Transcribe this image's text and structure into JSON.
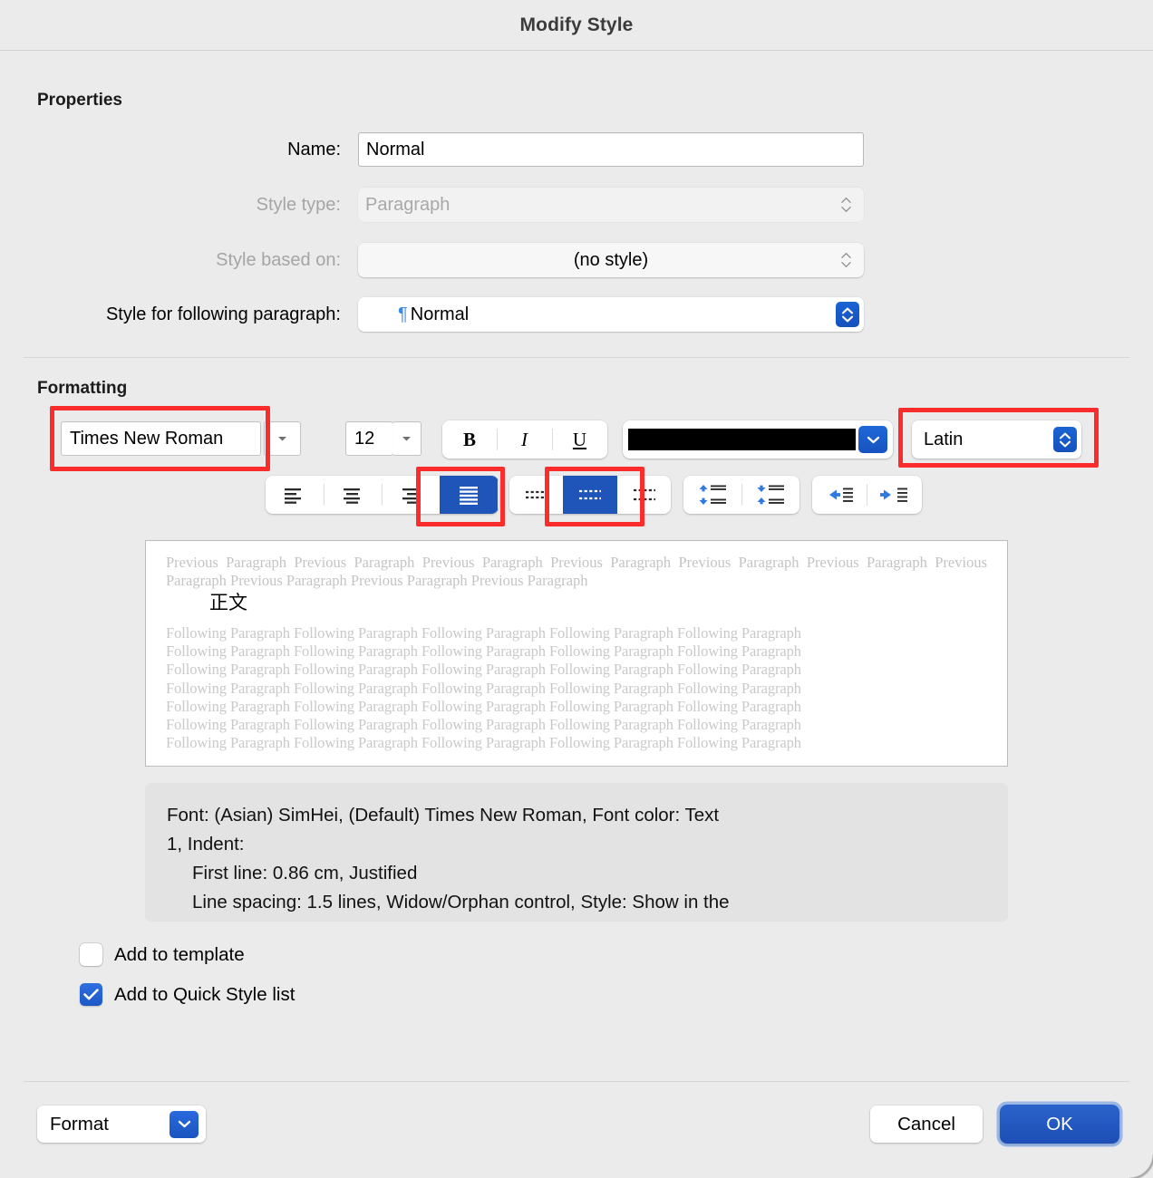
{
  "window": {
    "title": "Modify Style"
  },
  "properties": {
    "heading": "Properties",
    "name": {
      "label": "Name:",
      "value": "Normal"
    },
    "style_type": {
      "label": "Style type:",
      "value": "Paragraph"
    },
    "style_based_on": {
      "label": "Style based on:",
      "value": "(no style)"
    },
    "style_following": {
      "label": "Style for following paragraph:",
      "value": "Normal",
      "icon": "pilcrow-icon"
    }
  },
  "formatting": {
    "heading": "Formatting",
    "font_name": "Times New Roman",
    "font_size": "12",
    "bold_label": "B",
    "italic_label": "I",
    "underline_label": "U",
    "font_color": "#000000",
    "language": "Latin",
    "alignment": {
      "options": [
        "align-left-icon",
        "align-center-icon",
        "align-right-icon",
        "align-justify-icon"
      ],
      "selected": "align-justify-icon"
    },
    "line_spacing": {
      "options": [
        "line-spacing-single-icon",
        "line-spacing-1-5-icon",
        "line-spacing-double-icon"
      ],
      "selected": "line-spacing-1-5-icon"
    },
    "space_paragraph": {
      "options": [
        "decrease-space-before-icon",
        "increase-space-after-icon"
      ]
    },
    "indent": {
      "options": [
        "decrease-indent-icon",
        "increase-indent-icon"
      ]
    },
    "highlights": [
      "font-name-field",
      "alignment-justify-button",
      "line-spacing-1-5-button",
      "language-popup"
    ]
  },
  "preview": {
    "previous_paragraph": "Previous Paragraph Previous Paragraph Previous Paragraph Previous Paragraph Previous Paragraph Previous Paragraph Previous Paragraph Previous Paragraph Previous Paragraph Previous Paragraph",
    "sample_text": "正文",
    "following_line": "Following Paragraph Following Paragraph Following Paragraph Following Paragraph Following Paragraph",
    "following_line_count": 7
  },
  "description": {
    "line1": "Font: (Asian) SimHei, (Default) Times New Roman, Font color: Text",
    "line2": "1, Indent:",
    "line3": "First line:  0.86 cm, Justified",
    "line4": "Line spacing:  1.5 lines, Widow/Orphan control, Style: Show in the"
  },
  "options": {
    "add_to_template": {
      "label": "Add to template",
      "checked": false
    },
    "add_to_quick_style_list": {
      "label": "Add to Quick Style list",
      "checked": true
    }
  },
  "footer": {
    "format_label": "Format",
    "cancel_label": "Cancel",
    "ok_label": "OK"
  },
  "colors": {
    "accent_blue": "#1f55b8",
    "highlight_red": "#fb2c2c",
    "window_bg": "#ebebeb"
  }
}
